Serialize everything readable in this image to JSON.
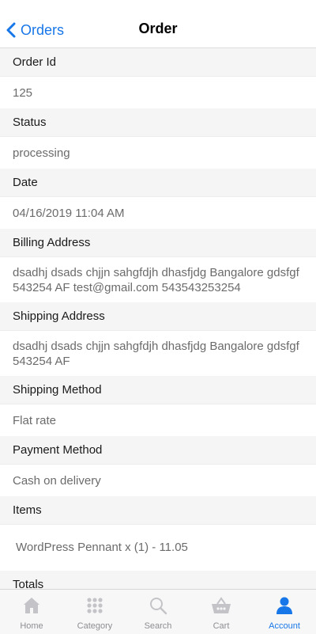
{
  "nav": {
    "back_label": "Orders",
    "title": "Order"
  },
  "sections": {
    "order_id": {
      "label": "Order Id",
      "value": "125"
    },
    "status": {
      "label": "Status",
      "value": "processing"
    },
    "date": {
      "label": "Date",
      "value": "04/16/2019 11:04 AM"
    },
    "billing": {
      "label": "Billing Address",
      "value": "dsadhj dsads chjjn sahgfdjh dhasfjdg Bangalore gdsfgf 543254 AF test@gmail.com 543543253254"
    },
    "shipping": {
      "label": "Shipping Address",
      "value": "dsadhj dsads chjjn sahgfdjh dhasfjdg Bangalore gdsfgf 543254 AF"
    },
    "shipping_method": {
      "label": "Shipping Method",
      "value": "Flat rate"
    },
    "payment_method": {
      "label": "Payment Method",
      "value": "Cash on delivery"
    },
    "items": {
      "label": "Items",
      "value": "WordPress Pennant x (1) - 11.05"
    },
    "totals": {
      "label": "Totals"
    }
  },
  "tabs": [
    {
      "label": "Home",
      "icon": "home-icon"
    },
    {
      "label": "Category",
      "icon": "grid-icon"
    },
    {
      "label": "Search",
      "icon": "search-icon"
    },
    {
      "label": "Cart",
      "icon": "basket-icon"
    },
    {
      "label": "Account",
      "icon": "user-icon",
      "active": true
    }
  ],
  "colors": {
    "accent": "#1877e8",
    "inactive": "#8e8e93",
    "section_bg": "#f5f5f5"
  }
}
